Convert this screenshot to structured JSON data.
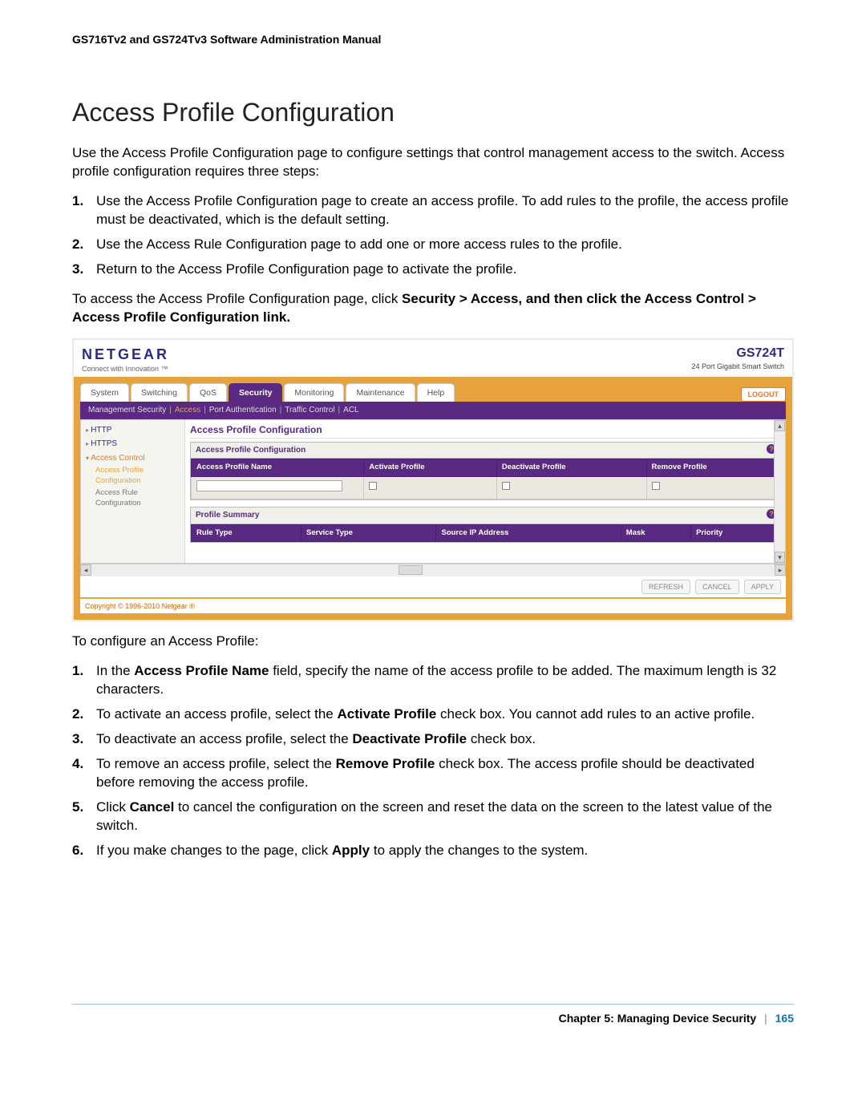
{
  "header": {
    "title": "GS716Tv2 and GS724Tv3 Software Administration Manual"
  },
  "section": {
    "title": "Access Profile Configuration",
    "intro": "Use the Access Profile Configuration page to configure settings that control management access to the switch. Access profile configuration requires three steps:",
    "steps1": [
      "Use the Access Profile Configuration page to create an access profile. To add rules to the profile, the access profile must be deactivated, which is the default setting.",
      "Use the Access Rule Configuration page to add one or more access rules to the profile.",
      "Return to the Access Profile Configuration page to activate the profile."
    ],
    "nav_pre": "To access the Access Profile Configuration page, click ",
    "nav_bold": "Security > Access, and then click the Access Control > Access Profile Configuration link.",
    "after_shot": "To configure an Access Profile:",
    "steps2": [
      {
        "pre": "In the ",
        "b1": "Access Profile Name",
        "mid": " field, specify the name of the access profile to be added. The maximum length is 32 characters."
      },
      {
        "pre": "To activate an access profile, select the ",
        "b1": "Activate Profile",
        "mid": " check box. You cannot add rules to an active profile."
      },
      {
        "pre": "To deactivate an access profile, select the ",
        "b1": "Deactivate Profile",
        "mid": " check box."
      },
      {
        "pre": "To remove an access profile, select the ",
        "b1": "Remove Profile",
        "mid": " check box. The access profile should be deactivated before removing the access profile."
      },
      {
        "pre": "Click ",
        "b1": "Cancel",
        "mid": " to cancel the configuration on the screen and reset the data on the screen to the latest value of the switch."
      },
      {
        "pre": "If you make changes to the page, click ",
        "b1": "Apply",
        "mid": " to apply the changes to the system."
      }
    ]
  },
  "shot": {
    "brand": "NETGEAR",
    "brand_tag": "Connect with Innovation ™",
    "device_model": "GS724T",
    "device_desc": "24 Port Gigabit Smart Switch",
    "tabs": [
      "System",
      "Switching",
      "QoS",
      "Security",
      "Monitoring",
      "Maintenance",
      "Help"
    ],
    "active_tab": "Security",
    "logout": "LOGOUT",
    "subnav": [
      "Management Security",
      "Access",
      "Port Authentication",
      "Traffic Control",
      "ACL"
    ],
    "subnav_active": "Access",
    "sidebar": {
      "items": [
        "HTTP",
        "HTTPS",
        "Access Control"
      ],
      "open": "Access Control",
      "subs": [
        "Access Profile Configuration",
        "Access Rule Configuration"
      ],
      "sub_sel": "Access Profile Configuration"
    },
    "panel_title": "Access Profile Configuration",
    "tbl1": {
      "caption": "Access Profile Configuration",
      "cols": [
        "Access Profile Name",
        "Activate Profile",
        "Deactivate Profile",
        "Remove Profile"
      ]
    },
    "tbl2": {
      "caption": "Profile Summary",
      "cols": [
        "Rule Type",
        "Service Type",
        "Source IP Address",
        "Mask",
        "Priority"
      ]
    },
    "actions": [
      "REFRESH",
      "CANCEL",
      "APPLY"
    ],
    "copyright": "Copyright © 1996-2010 Netgear ®"
  },
  "footer": {
    "chapter": "Chapter 5:  Managing Device Security",
    "page": "165"
  }
}
